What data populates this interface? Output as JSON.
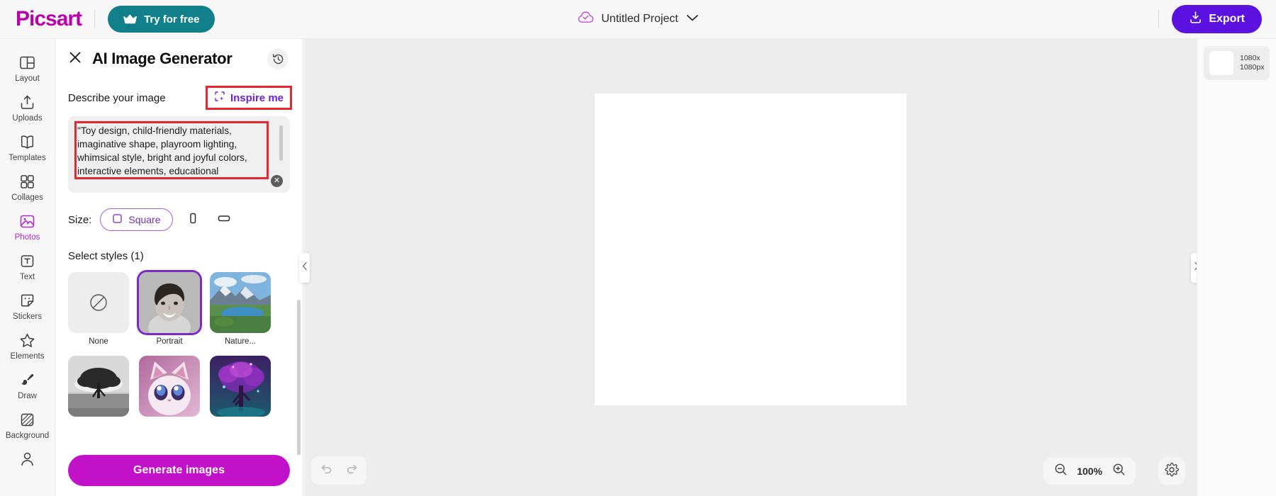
{
  "topbar": {
    "brand": "Picsart",
    "try_label": "Try for free",
    "try_icon": "crown-icon",
    "project_name": "Untitled Project",
    "project_icon": "cloud-check-icon",
    "project_chevron": "chevron-down-icon",
    "export_label": "Export",
    "export_icon": "download-icon",
    "brand_color": "#bb00aa",
    "try_color": "#12808a",
    "export_color": "#5b12e0"
  },
  "sidebar": {
    "items": [
      {
        "label": "Layout",
        "icon": "layout-icon",
        "active": false
      },
      {
        "label": "Uploads",
        "icon": "upload-icon",
        "active": false
      },
      {
        "label": "Templates",
        "icon": "templates-icon",
        "active": false
      },
      {
        "label": "Collages",
        "icon": "collages-icon",
        "active": false
      },
      {
        "label": "Photos",
        "icon": "photos-icon",
        "active": true
      },
      {
        "label": "Text",
        "icon": "text-icon",
        "active": false
      },
      {
        "label": "Stickers",
        "icon": "stickers-icon",
        "active": false
      },
      {
        "label": "Elements",
        "icon": "star-icon",
        "active": false
      },
      {
        "label": "Draw",
        "icon": "brush-icon",
        "active": false
      },
      {
        "label": "Background",
        "icon": "background-icon",
        "active": false
      },
      {
        "label": "",
        "icon": "person-icon",
        "active": false
      }
    ],
    "active_color": "#b02ad0"
  },
  "panel": {
    "title": "AI Image Generator",
    "close_icon": "close-icon",
    "history_icon": "history-icon",
    "describe_label": "Describe your image",
    "inspire_label": "Inspire me",
    "inspire_icon": "inspire-sparkle-icon",
    "inspire_color": "#6b22e8",
    "prompt_value": "\"Toy design, child-friendly materials, imaginative shape, playroom lighting, whimsical style, bright and joyful colors, interactive elements, educational",
    "prompt_placeholder": "Describe your image",
    "clear_icon": "clear-circle-icon",
    "size_label": "Size:",
    "size_options": [
      {
        "label": "Square",
        "icon": "square-icon",
        "selected": true
      },
      {
        "label": "",
        "icon": "portrait-icon",
        "selected": false
      },
      {
        "label": "",
        "icon": "landscape-icon",
        "selected": false
      }
    ],
    "styles_label": "Select styles (1)",
    "styles": [
      {
        "name": "None",
        "thumb": "none-slash-icon",
        "selected": false
      },
      {
        "name": "Portrait",
        "thumb": "portrait-boy-photo",
        "selected": true
      },
      {
        "name": "Nature...",
        "thumb": "nature-mountain-lake-photo",
        "selected": false
      },
      {
        "name": "",
        "thumb": "bw-tree-photo",
        "selected": false
      },
      {
        "name": "",
        "thumb": "pink-cat-anime-photo",
        "selected": false
      },
      {
        "name": "",
        "thumb": "magic-purple-tree-photo",
        "selected": false
      }
    ],
    "generate_label": "Generate images",
    "generate_color": "#c211c9",
    "annotation_color": "#e8262f"
  },
  "canvas": {
    "collapse_left_icon": "chevron-left-icon",
    "collapse_right_icon": "chevron-right-icon",
    "undo_icon": "undo-icon",
    "redo_icon": "redo-icon",
    "zoom_out_icon": "zoom-out-icon",
    "zoom_in_icon": "zoom-in-icon",
    "zoom_value": "100%",
    "settings_icon": "gear-icon"
  },
  "right_panel": {
    "layer_dimensions": "1080x\n1080px"
  }
}
